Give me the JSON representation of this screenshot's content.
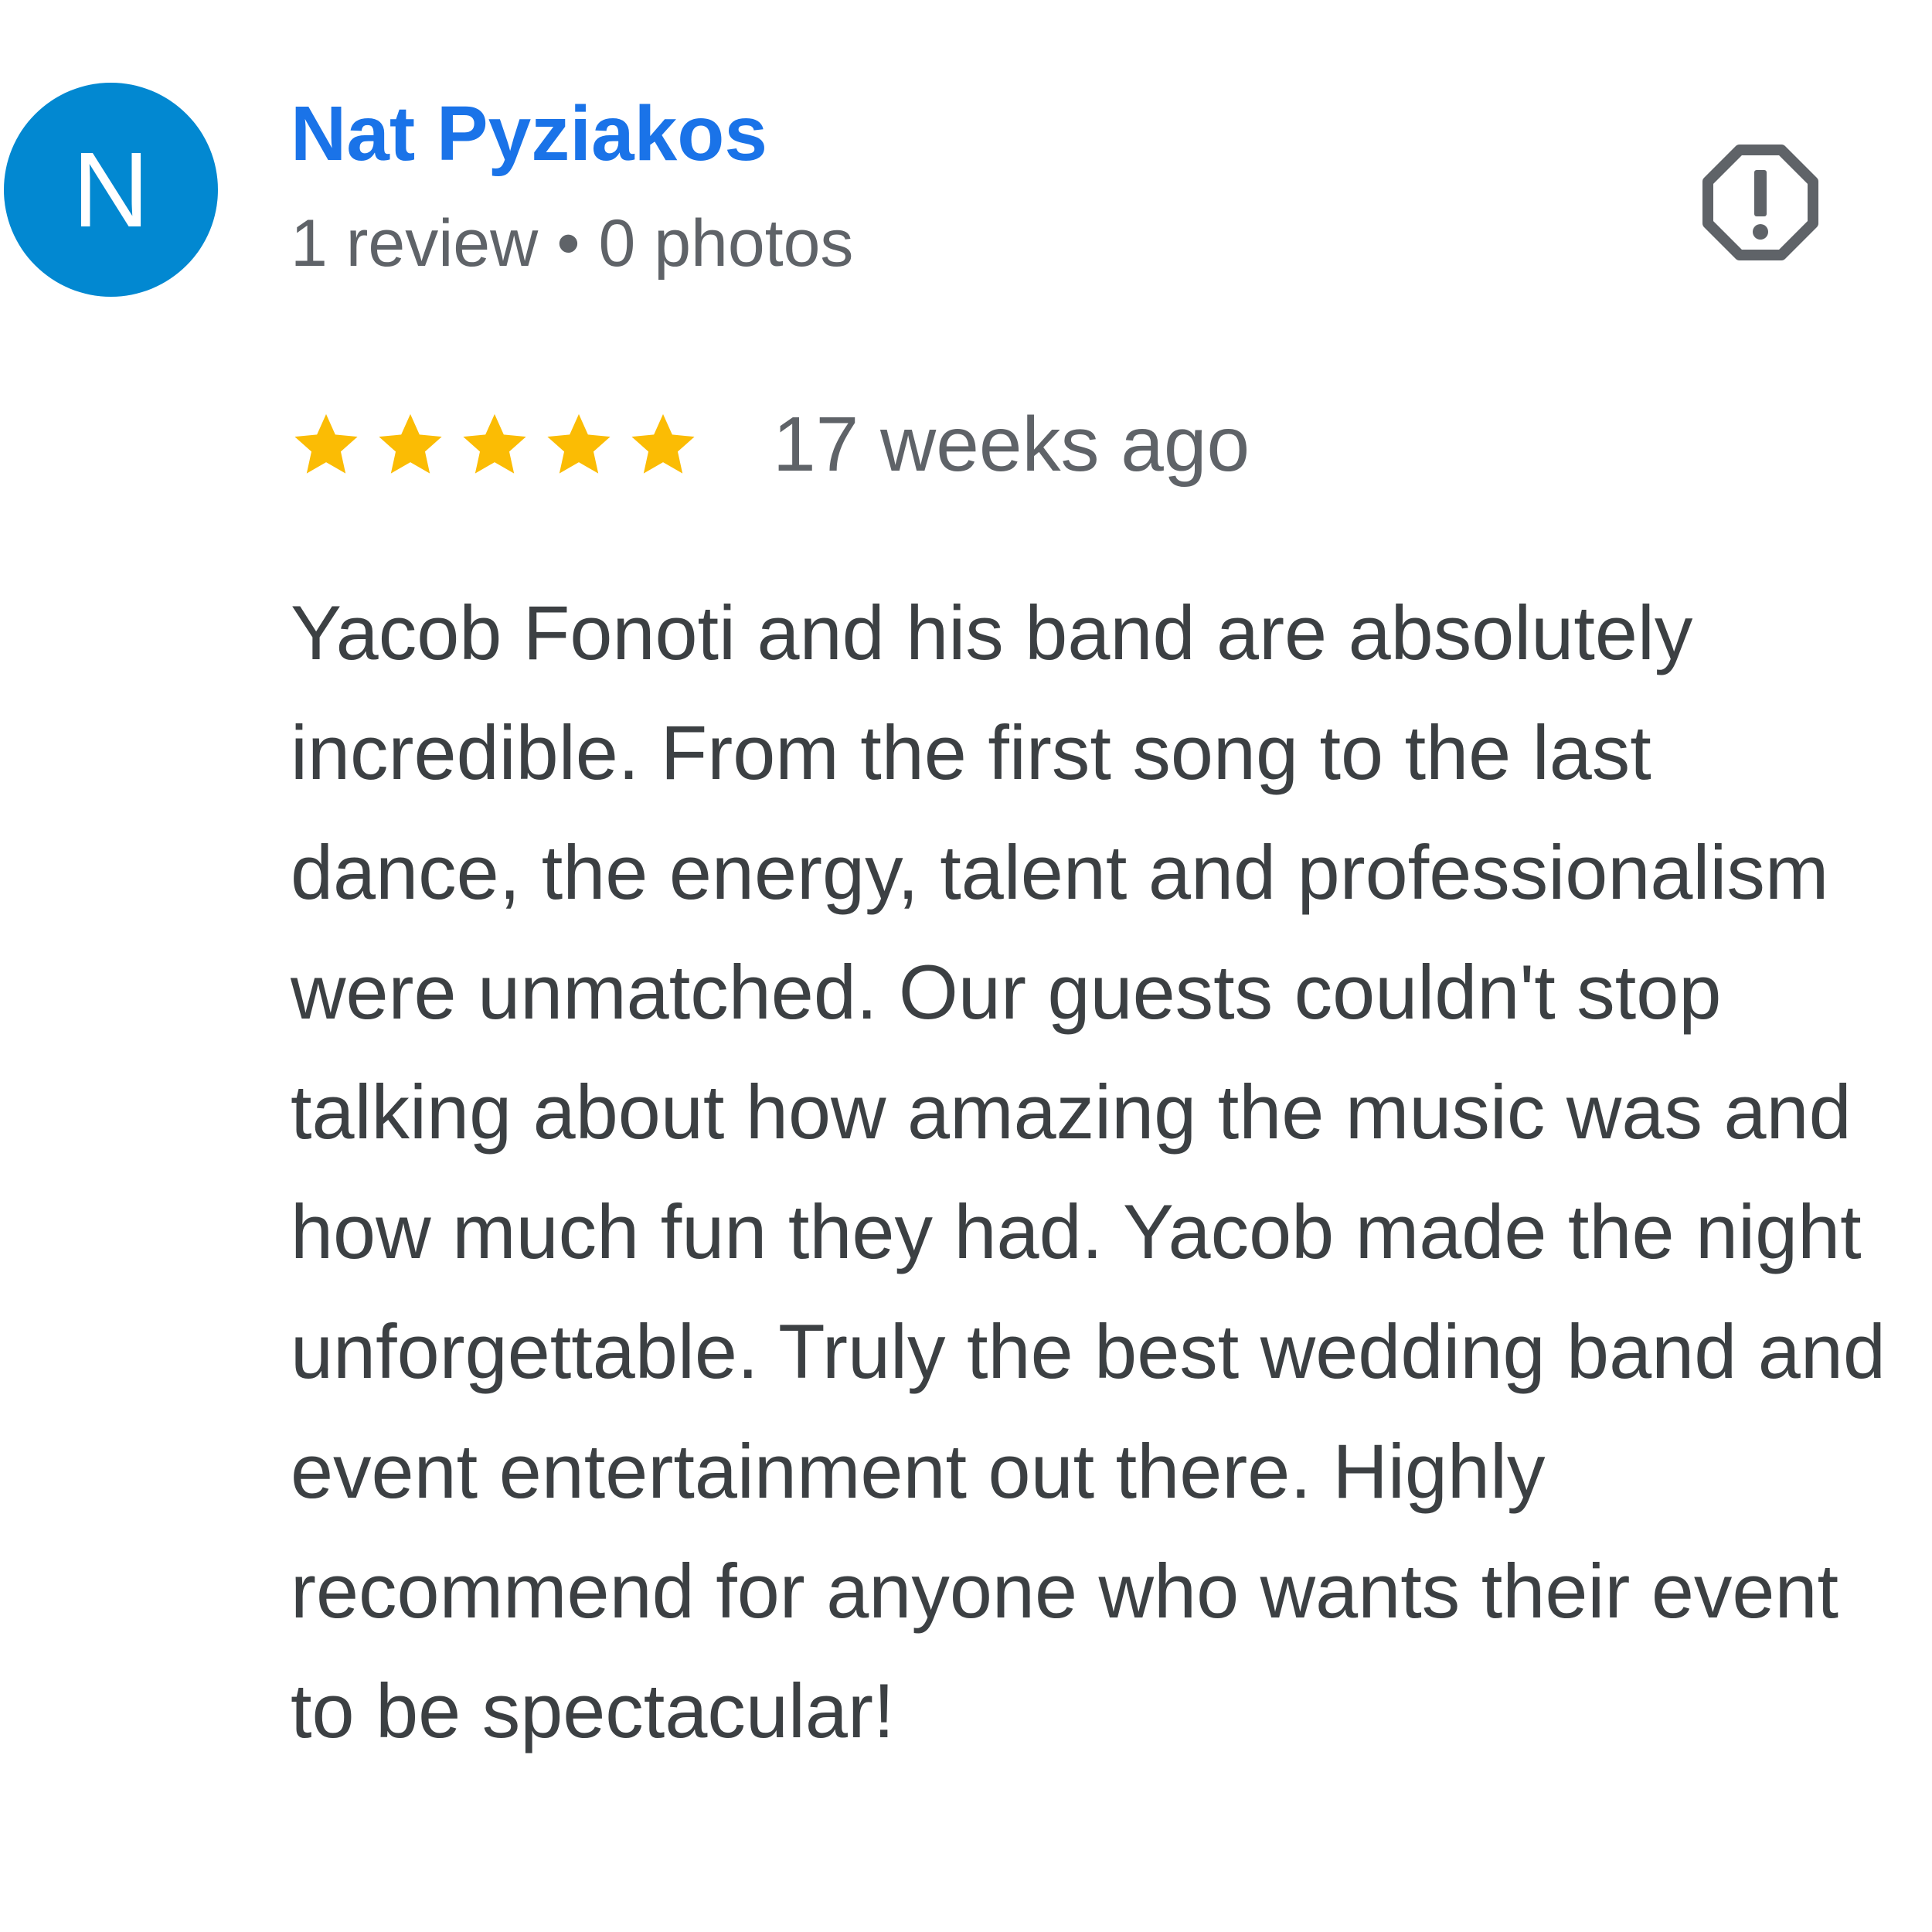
{
  "reviewer": {
    "avatar_letter": "N",
    "avatar_color": "#0288d1",
    "name": "Nat Pyziakos",
    "review_count": "1 review",
    "separator": "•",
    "photo_count": "0 photos"
  },
  "rating": {
    "stars": 5,
    "max_stars": 5,
    "star_color": "#fbbc04",
    "date": "17 weeks ago"
  },
  "review": {
    "text": "Yacob Fonoti and his band are absolutely incredible. From the first song to the last dance, the energy, talent and professionalism were unmatched. Our guests couldn't stop talking about how amazing the music was and how much fun they had. Yacob made the night unforgettable. Truly the best wedding band and event entertainment out there. Highly recommend for anyone who wants their event to be spectacular!"
  },
  "actions": {
    "report_icon": "report-icon"
  },
  "colors": {
    "name": "#1a73e8",
    "meta": "#5f6368",
    "body_text": "#3c4043",
    "icon": "#5f6368"
  }
}
